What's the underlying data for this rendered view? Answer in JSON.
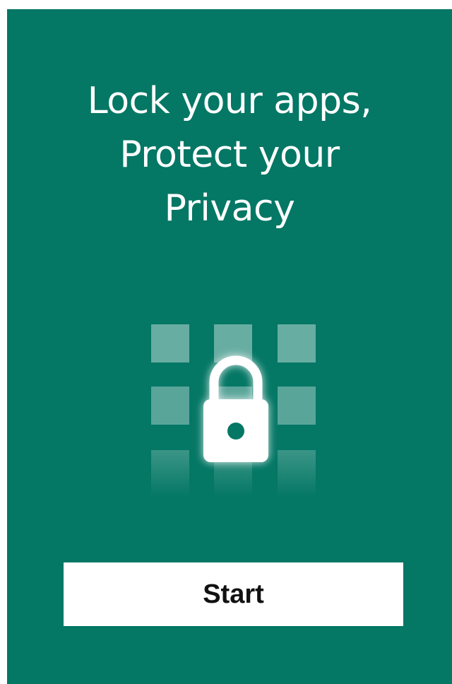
{
  "headline": {
    "line1": "Lock your apps,",
    "line2": "Protect your",
    "line3": "Privacy"
  },
  "illustration": {
    "icon": "lock-icon"
  },
  "start_button": {
    "label": "Start"
  },
  "colors": {
    "background": "#047765",
    "button_background": "#ffffff",
    "text_primary": "#ffffff",
    "button_text": "#111111"
  }
}
